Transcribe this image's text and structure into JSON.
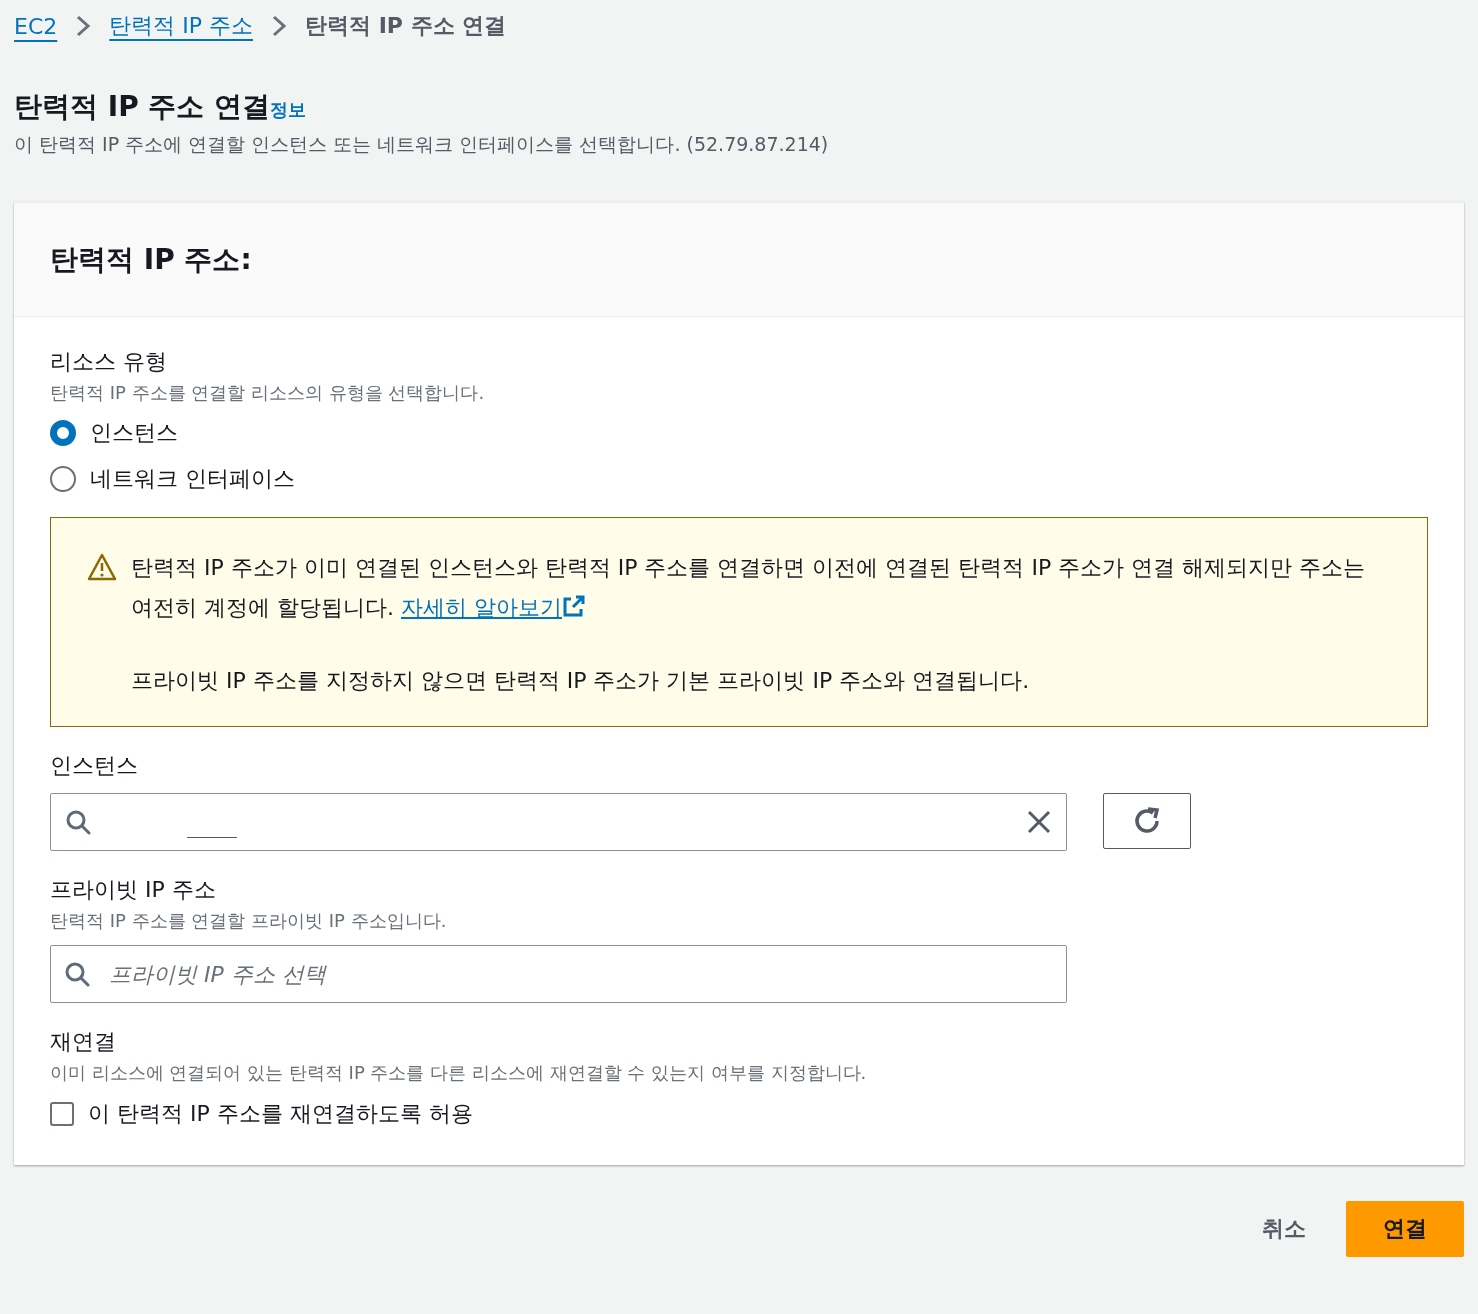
{
  "breadcrumb": [
    {
      "label": "EC2",
      "kind": "link"
    },
    {
      "label": "탄력적 IP 주소",
      "kind": "link"
    },
    {
      "label": "탄력적 IP 주소 연결",
      "kind": "current"
    }
  ],
  "page": {
    "title": "탄력적 IP 주소 연결",
    "info_link": "정보",
    "description": "이 탄력적 IP 주소에 연결할 인스턴스 또는 네트워크 인터페이스를 선택합니다. (52.79.87.214)"
  },
  "card": {
    "title": "탄력적 IP 주소:",
    "resource_type": {
      "label": "리소스 유형",
      "description": "탄력적 IP 주소를 연결할 리소스의 유형을 선택합니다.",
      "options": [
        {
          "label": "인스턴스",
          "selected": true
        },
        {
          "label": "네트워크 인터페이스",
          "selected": false
        }
      ]
    },
    "alert": {
      "text": "탄력적 IP 주소가 이미 연결된 인스턴스와 탄력적 IP 주소를 연결하면 이전에 연결된 탄력적 IP 주소가 연결 해제되지만 주소는 여전히 계정에 할당됩니다.",
      "link": "자세히 알아보기",
      "note": "프라이빗 IP 주소를 지정하지 않으면 탄력적 IP 주소가 기본 프라이빗 IP 주소와 연결됩니다."
    },
    "instance": {
      "label": "인스턴스"
    },
    "private_ip": {
      "label": "프라이빗 IP 주소",
      "description": "탄력적 IP 주소를 연결할 프라이빗 IP 주소입니다.",
      "placeholder": "프라이빗 IP 주소 선택"
    },
    "reassociation": {
      "label": "재연결",
      "description": "이미 리소스에 연결되어 있는 탄력적 IP 주소를 다른 리소스에 재연결할 수 있는지 여부를 지정합니다.",
      "checkbox": {
        "label": "이 탄력적 IP 주소를 재연결하도록 허용",
        "checked": false
      }
    }
  },
  "buttons": [
    {
      "label": "취소",
      "kind": "cancel"
    },
    {
      "label": "연결",
      "kind": "primary"
    }
  ]
}
